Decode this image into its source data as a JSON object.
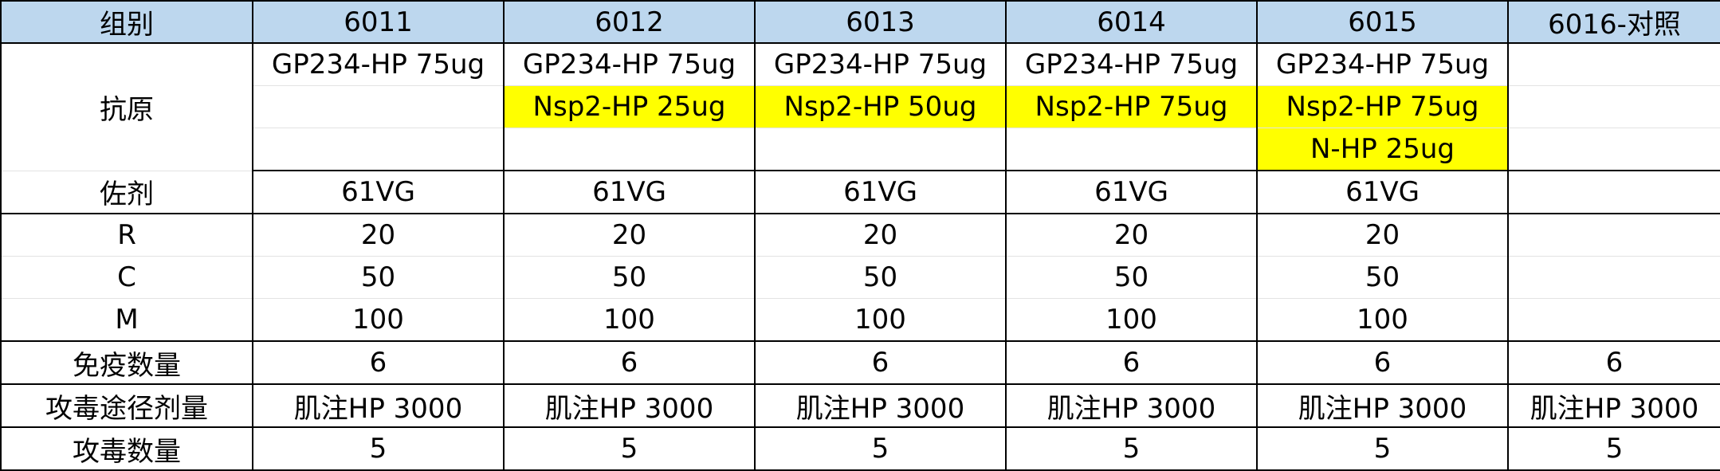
{
  "header": {
    "label": "组别",
    "groups": [
      "6011",
      "6012",
      "6013",
      "6014",
      "6015",
      "6016-对照"
    ]
  },
  "antigen": {
    "label": "抗原",
    "row1": [
      "GP234-HP 75ug",
      "GP234-HP 75ug",
      "GP234-HP 75ug",
      "GP234-HP 75ug",
      "GP234-HP 75ug",
      ""
    ],
    "row2": [
      "",
      "Nsp2-HP 25ug",
      "Nsp2-HP 50ug",
      "Nsp2-HP 75ug",
      "Nsp2-HP 75ug",
      ""
    ],
    "row3": [
      "",
      "",
      "",
      "",
      "N-HP 25ug",
      ""
    ]
  },
  "adjuvant": {
    "label": "佐剂",
    "values": [
      "61VG",
      "61VG",
      "61VG",
      "61VG",
      "61VG",
      ""
    ]
  },
  "dose": {
    "r_label": "R",
    "r_values": [
      "20",
      "20",
      "20",
      "20",
      "20",
      ""
    ],
    "c_label": "C",
    "c_values": [
      "50",
      "50",
      "50",
      "50",
      "50",
      ""
    ],
    "m_label": "M",
    "m_values": [
      "100",
      "100",
      "100",
      "100",
      "100",
      ""
    ]
  },
  "immunized_count": {
    "label": "免疫数量",
    "values": [
      "6",
      "6",
      "6",
      "6",
      "6",
      "6"
    ]
  },
  "challenge_route": {
    "label": "攻毒途径剂量",
    "values": [
      "肌注HP 3000",
      "肌注HP 3000",
      "肌注HP 3000",
      "肌注HP 3000",
      "肌注HP 3000",
      "肌注HP 3000"
    ]
  },
  "challenge_count": {
    "label": "攻毒数量",
    "values": [
      "5",
      "5",
      "5",
      "5",
      "5",
      "5"
    ]
  },
  "highlight_color": "#ffff00",
  "header_color": "#bdd7ee"
}
